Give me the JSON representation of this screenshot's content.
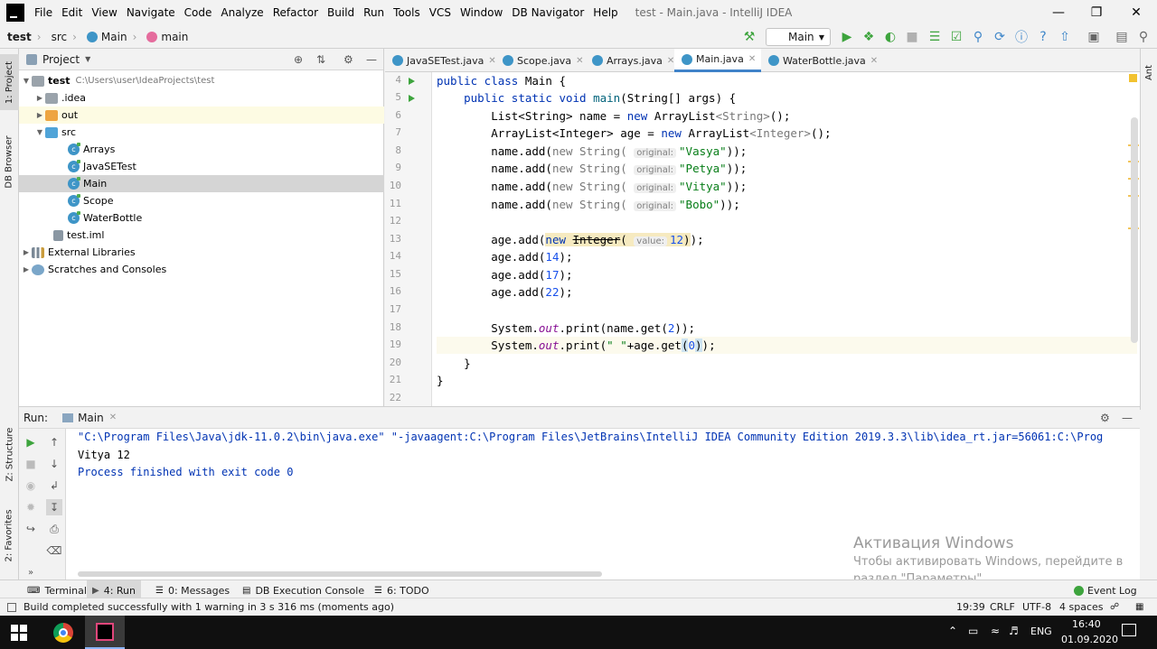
{
  "menubar": {
    "items": [
      "File",
      "Edit",
      "View",
      "Navigate",
      "Code",
      "Analyze",
      "Refactor",
      "Build",
      "Run",
      "Tools",
      "VCS",
      "Window",
      "DB Navigator",
      "Help"
    ],
    "window_title": "test - Main.java - IntelliJ IDEA"
  },
  "navbar": {
    "breadcrumbs": [
      "test",
      "src",
      "Main",
      "main"
    ],
    "run_config": "Main"
  },
  "left_strip": {
    "project": "1: Project",
    "db_browser": "DB Browser",
    "structure": "Z: Structure",
    "favorites": "2: Favorites"
  },
  "right_strip": {
    "ant": "Ant"
  },
  "project_panel": {
    "title": "Project",
    "tree": [
      {
        "label": "test",
        "extra": "C:\\Users\\user\\IdeaProjects\\test"
      },
      {
        "label": ".idea"
      },
      {
        "label": "out"
      },
      {
        "label": "src"
      },
      {
        "label": "Arrays"
      },
      {
        "label": "JavaSETest"
      },
      {
        "label": "Main"
      },
      {
        "label": "Scope"
      },
      {
        "label": "WaterBottle"
      },
      {
        "label": "test.iml"
      },
      {
        "label": "External Libraries"
      },
      {
        "label": "Scratches and Consoles"
      }
    ]
  },
  "editor": {
    "tabs": [
      "JavaSETest.java",
      "Scope.java",
      "Arrays.java",
      "Main.java",
      "WaterBottle.java"
    ],
    "active_tab": "Main.java",
    "line_numbers": [
      "4",
      "5",
      "6",
      "7",
      "8",
      "9",
      "10",
      "11",
      "12",
      "13",
      "14",
      "15",
      "16",
      "17",
      "18",
      "19",
      "20",
      "21",
      "22"
    ]
  },
  "run_panel": {
    "label": "Run:",
    "tab": "Main",
    "output": [
      "\"C:\\Program Files\\Java\\jdk-11.0.2\\bin\\java.exe\" \"-javaagent:C:\\Program Files\\JetBrains\\IntelliJ IDEA Community Edition 2019.3.3\\lib\\idea_rt.jar=56061:C:\\Prog",
      "Vitya 12",
      "",
      "Process finished with exit code 0"
    ]
  },
  "watermark": {
    "title": "Активация Windows",
    "line1": "Чтобы активировать Windows, перейдите в",
    "line2": "раздел \"Параметры\"."
  },
  "tool_windows": {
    "terminal": "Terminal",
    "run": "4: Run",
    "messages": "0: Messages",
    "db_console": "DB Execution Console",
    "todo": "6: TODO",
    "event_log": "Event Log"
  },
  "status": {
    "message": "Build completed successfully with 1 warning in 3 s 316 ms (moments ago)",
    "position": "19:39",
    "line_sep": "CRLF",
    "encoding": "UTF-8",
    "indent": "4 spaces"
  },
  "taskbar": {
    "lang": "ENG",
    "time": "16:40",
    "date": "01.09.2020"
  }
}
